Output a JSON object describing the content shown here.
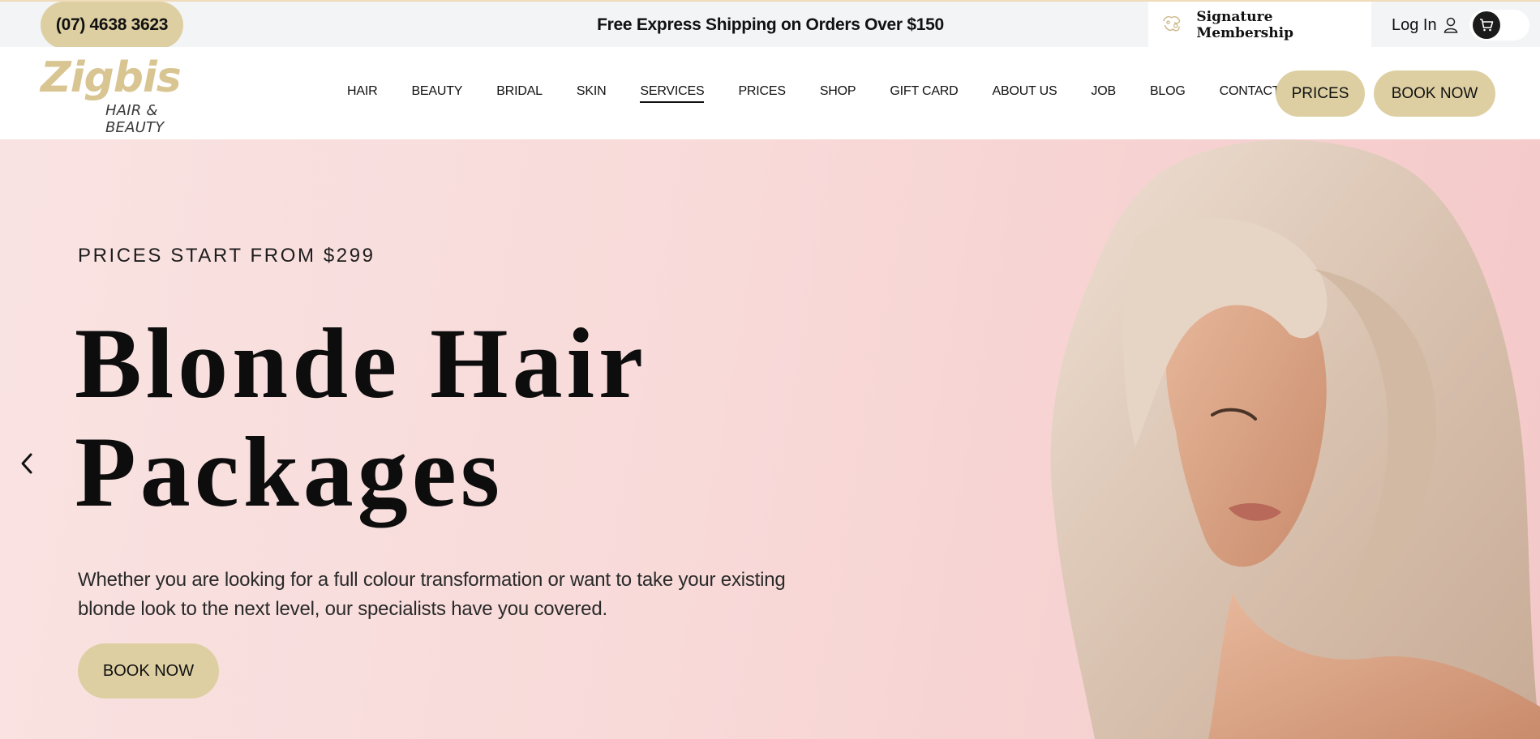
{
  "topbar": {
    "phone": "(07) 4638 3623",
    "shipping": "Free Express Shipping on Orders Over $150",
    "membership": "Signature Membership",
    "login": "Log In",
    "icons": [
      "membership-icon",
      "user-icon",
      "cart-icon"
    ]
  },
  "logo": {
    "main": "Zigbis",
    "sub": "HAIR & BEAUTY"
  },
  "nav": {
    "items": [
      {
        "label": "HAIR"
      },
      {
        "label": "BEAUTY"
      },
      {
        "label": "BRIDAL"
      },
      {
        "label": "SKIN"
      },
      {
        "label": "SERVICES",
        "active": true
      },
      {
        "label": "PRICES"
      },
      {
        "label": "SHOP"
      },
      {
        "label": "GIFT CARD"
      },
      {
        "label": "ABOUT US"
      },
      {
        "label": "JOB"
      },
      {
        "label": "BLOG"
      },
      {
        "label": "CONTACT US"
      }
    ],
    "prices_button": "PRICES",
    "book_button": "BOOK NOW"
  },
  "hero": {
    "eyebrow": "PRICES START FROM $299",
    "headline_line1": "Blonde Hair",
    "headline_line2": "Packages",
    "description": "Whether you are looking for a full colour transformation or want to take your existing blonde look to the next level, our specialists have you covered.",
    "button": "BOOK NOW",
    "image": "blonde-woman-portrait"
  },
  "colors": {
    "accent": "#ddcfa2",
    "logo": "#d8c592",
    "hero_bg": "#f8dad9",
    "topbar_bg": "#f3f4f6"
  }
}
